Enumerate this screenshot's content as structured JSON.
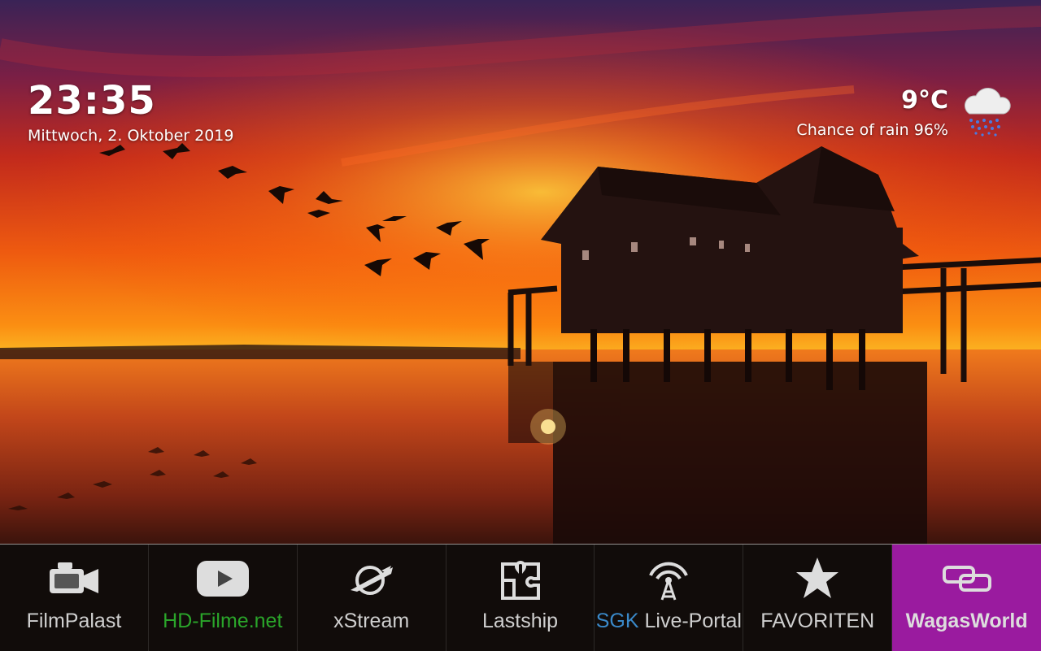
{
  "clock": {
    "time": "23:35",
    "date": "Mittwoch, 2. Oktober 2019"
  },
  "weather": {
    "temperature": "9°C",
    "rain": "Chance of rain 96%",
    "icon": "rain-cloud-icon"
  },
  "menu": {
    "items": [
      {
        "label": "FilmPalast",
        "icon": "video-camera-icon"
      },
      {
        "label": "HD-Filme.net",
        "icon": "play-button-icon",
        "color": "#2aa52a"
      },
      {
        "label": "xStream",
        "icon": "planet-rocket-icon"
      },
      {
        "label": "Lastship",
        "icon": "puzzle-icon"
      },
      {
        "label_prefix": "SGK",
        "label": "Live-Portal",
        "prefix_color": "#3a89c9",
        "icon": "broadcast-tower-icon"
      },
      {
        "label": "FAVORITEN",
        "icon": "star-icon"
      },
      {
        "label": "WagasWorld",
        "icon": "link-icon",
        "active": true
      }
    ],
    "active_color": "#9a1b9f"
  }
}
